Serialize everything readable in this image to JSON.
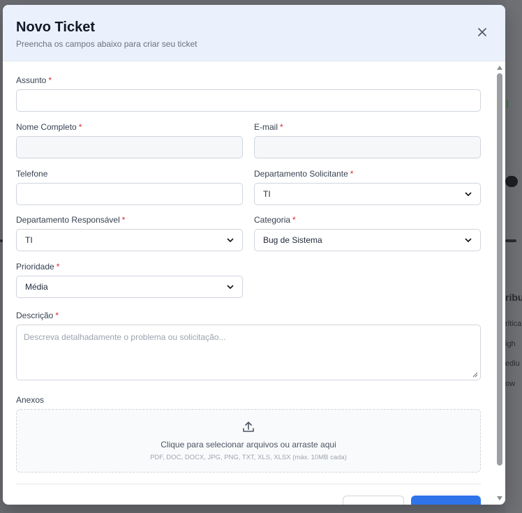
{
  "modal": {
    "title": "Novo Ticket",
    "subtitle": "Preencha os campos abaixo para criar seu ticket",
    "close_icon": "close-icon"
  },
  "form": {
    "required_mark": "*",
    "assunto": {
      "label": "Assunto",
      "value": ""
    },
    "nome": {
      "label": "Nome Completo",
      "value": ""
    },
    "email": {
      "label": "E-mail",
      "value": ""
    },
    "telefone": {
      "label": "Telefone",
      "value": ""
    },
    "dep_solicitante": {
      "label": "Departamento Solicitante",
      "value": "TI"
    },
    "dep_responsavel": {
      "label": "Departamento Responsável",
      "value": "TI"
    },
    "categoria": {
      "label": "Categoria",
      "value": "Bug de Sistema"
    },
    "prioridade": {
      "label": "Prioridade",
      "value": "Média"
    },
    "descricao": {
      "label": "Descrição",
      "placeholder": "Descreva detalhadamente o problema ou solicitação..."
    },
    "anexos": {
      "label": "Anexos",
      "drop_text": "Clique para selecionar arquivos ou arraste aqui",
      "formats": "PDF, DOC, DOCX, JPG, PNG, TXT, XLS, XLSX (máx. 10MB cada)",
      "icon": "upload-icon"
    }
  },
  "background": {
    "fragments": [
      "ribu",
      "ritica",
      "igh",
      "ediu",
      "ow"
    ]
  },
  "colors": {
    "accent": "#2f74e8",
    "required": "#dc2626",
    "header_bg": "#eaf1fc"
  }
}
